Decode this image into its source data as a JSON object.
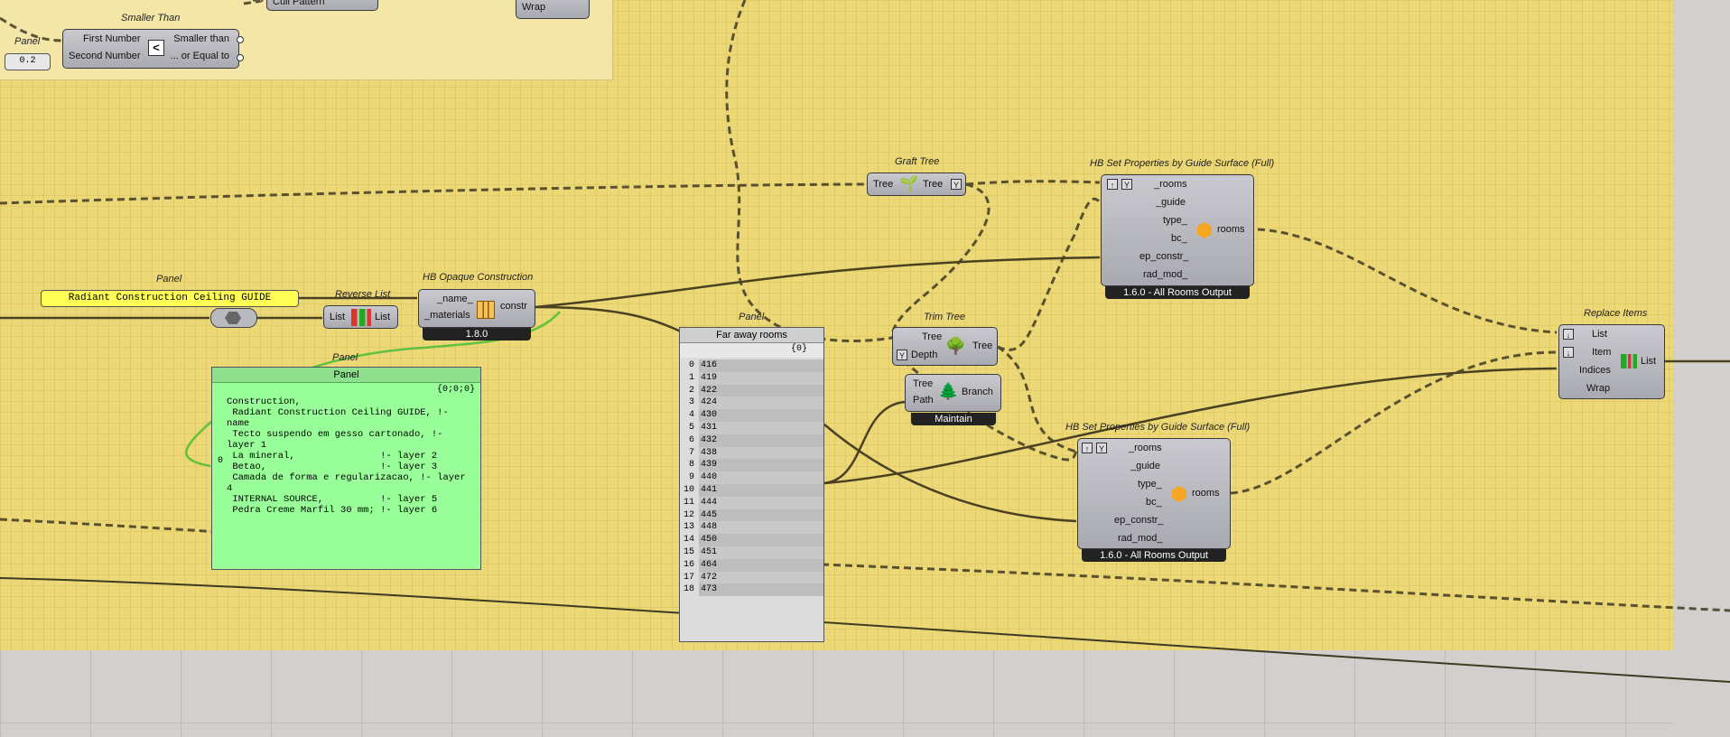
{
  "smaller_than": {
    "title": "Smaller Than",
    "inputs": [
      "First Number",
      "Second Number"
    ],
    "symbol": "<",
    "outputs": [
      "Smaller than",
      "... or Equal to"
    ]
  },
  "panel_value": {
    "title": "Panel",
    "value": "0.2"
  },
  "top_partial": {
    "left_label": "Cull Pattern",
    "right_label": "Wrap"
  },
  "graft_tree": {
    "title": "Graft Tree",
    "input": "Tree",
    "output": "Tree"
  },
  "hb_set_top": {
    "title": "HB Set Properties by Guide Surface (Full)",
    "inputs": [
      "_rooms",
      "_guide",
      "type_",
      "bc_",
      "ep_constr_",
      "rad_mod_"
    ],
    "output": "rooms",
    "version": "1.6.0 - All Rooms Output"
  },
  "panel_guide": {
    "title": "Panel",
    "text": "Radiant Construction Ceiling GUIDE"
  },
  "reverse_list": {
    "title": "Reverse List",
    "input": "List",
    "output": "List"
  },
  "hb_opaque": {
    "title": "HB Opaque Construction",
    "inputs": [
      "_name_",
      "_materials"
    ],
    "output": "constr",
    "version": "1.8.0"
  },
  "panel_construction": {
    "title": "Panel",
    "header": "Panel",
    "path": "{0;0;0}",
    "index": "0",
    "text": "Construction,\n Radiant Construction Ceiling GUIDE, !- name\n Tecto suspendo em gesso cartonado, !- layer 1\n La mineral,               !- layer 2\n Betao,                    !- layer 3\n Camada de forma e regularizacao, !- layer 4\n INTERNAL SOURCE,          !- layer 5\n Pedra Creme Marfil 30 mm; !- layer 6"
  },
  "panel_rooms": {
    "title": "Panel",
    "header": "Far away rooms",
    "path": "{0}",
    "rows": [
      {
        "i": "0",
        "v": "416"
      },
      {
        "i": "1",
        "v": "419"
      },
      {
        "i": "2",
        "v": "422"
      },
      {
        "i": "3",
        "v": "424"
      },
      {
        "i": "4",
        "v": "430"
      },
      {
        "i": "5",
        "v": "431"
      },
      {
        "i": "6",
        "v": "432"
      },
      {
        "i": "7",
        "v": "438"
      },
      {
        "i": "8",
        "v": "439"
      },
      {
        "i": "9",
        "v": "440"
      },
      {
        "i": "10",
        "v": "441"
      },
      {
        "i": "11",
        "v": "444"
      },
      {
        "i": "12",
        "v": "445"
      },
      {
        "i": "13",
        "v": "448"
      },
      {
        "i": "14",
        "v": "450"
      },
      {
        "i": "15",
        "v": "451"
      },
      {
        "i": "16",
        "v": "464"
      },
      {
        "i": "17",
        "v": "472"
      },
      {
        "i": "18",
        "v": "473"
      }
    ]
  },
  "trim_tree": {
    "title": "Trim Tree",
    "inputs": [
      "Tree",
      "Depth"
    ],
    "output": "Tree"
  },
  "tree_branch": {
    "inputs": [
      "Tree",
      "Path"
    ],
    "output": "Branch",
    "mode": "Maintain"
  },
  "hb_set_bottom": {
    "title": "HB Set Properties by Guide Surface (Full)",
    "inputs": [
      "_rooms",
      "_guide",
      "type_",
      "bc_",
      "ep_constr_",
      "rad_mod_"
    ],
    "output": "rooms",
    "version": "1.6.0 - All Rooms Output"
  },
  "replace_items": {
    "title": "Replace Items",
    "inputs": [
      "List",
      "Item",
      "Indices",
      "Wrap"
    ],
    "output": "List"
  }
}
